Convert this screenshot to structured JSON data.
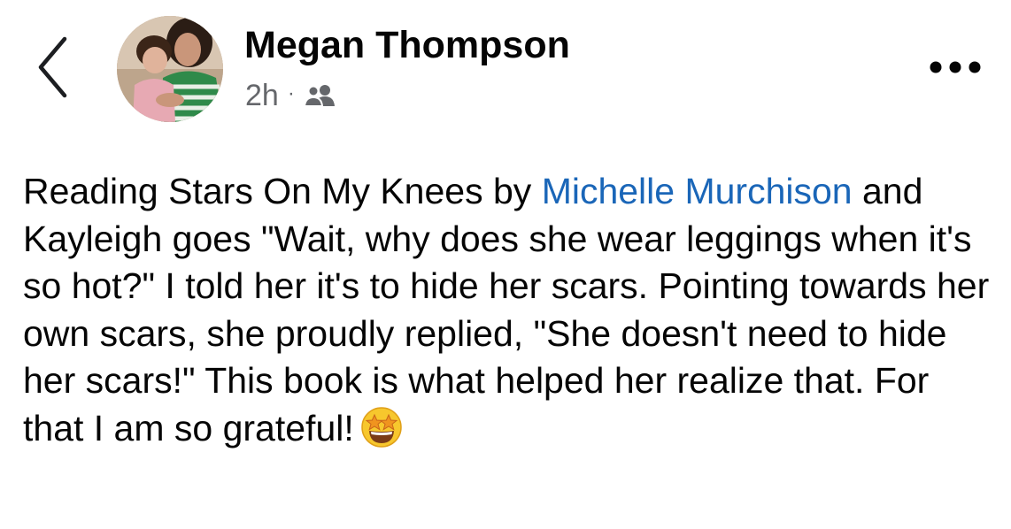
{
  "post": {
    "author_name": "Megan Thompson",
    "timestamp": "2h",
    "separator": "·",
    "audience_icon": "friends-icon",
    "menu_icon": "more-horizontal-icon",
    "back_icon": "chevron-left-icon",
    "body": {
      "text_1": "Reading Stars On My Knees by",
      "mention": "Michelle Murchison",
      "text_2": "and Kayleigh goes \"Wait, why does she wear leggings when it's so hot?\" I told her it's to hide her scars. Pointing towards her own scars, she proudly replied, \"She doesn't need to hide her scars!\"  This book is what helped her realize that. For that I am so grateful!",
      "emoji": "star-struck-emoji"
    }
  },
  "colors": {
    "name_text": "#050505",
    "meta_text": "#65676b",
    "link": "#1a66b8",
    "background": "#ffffff"
  }
}
